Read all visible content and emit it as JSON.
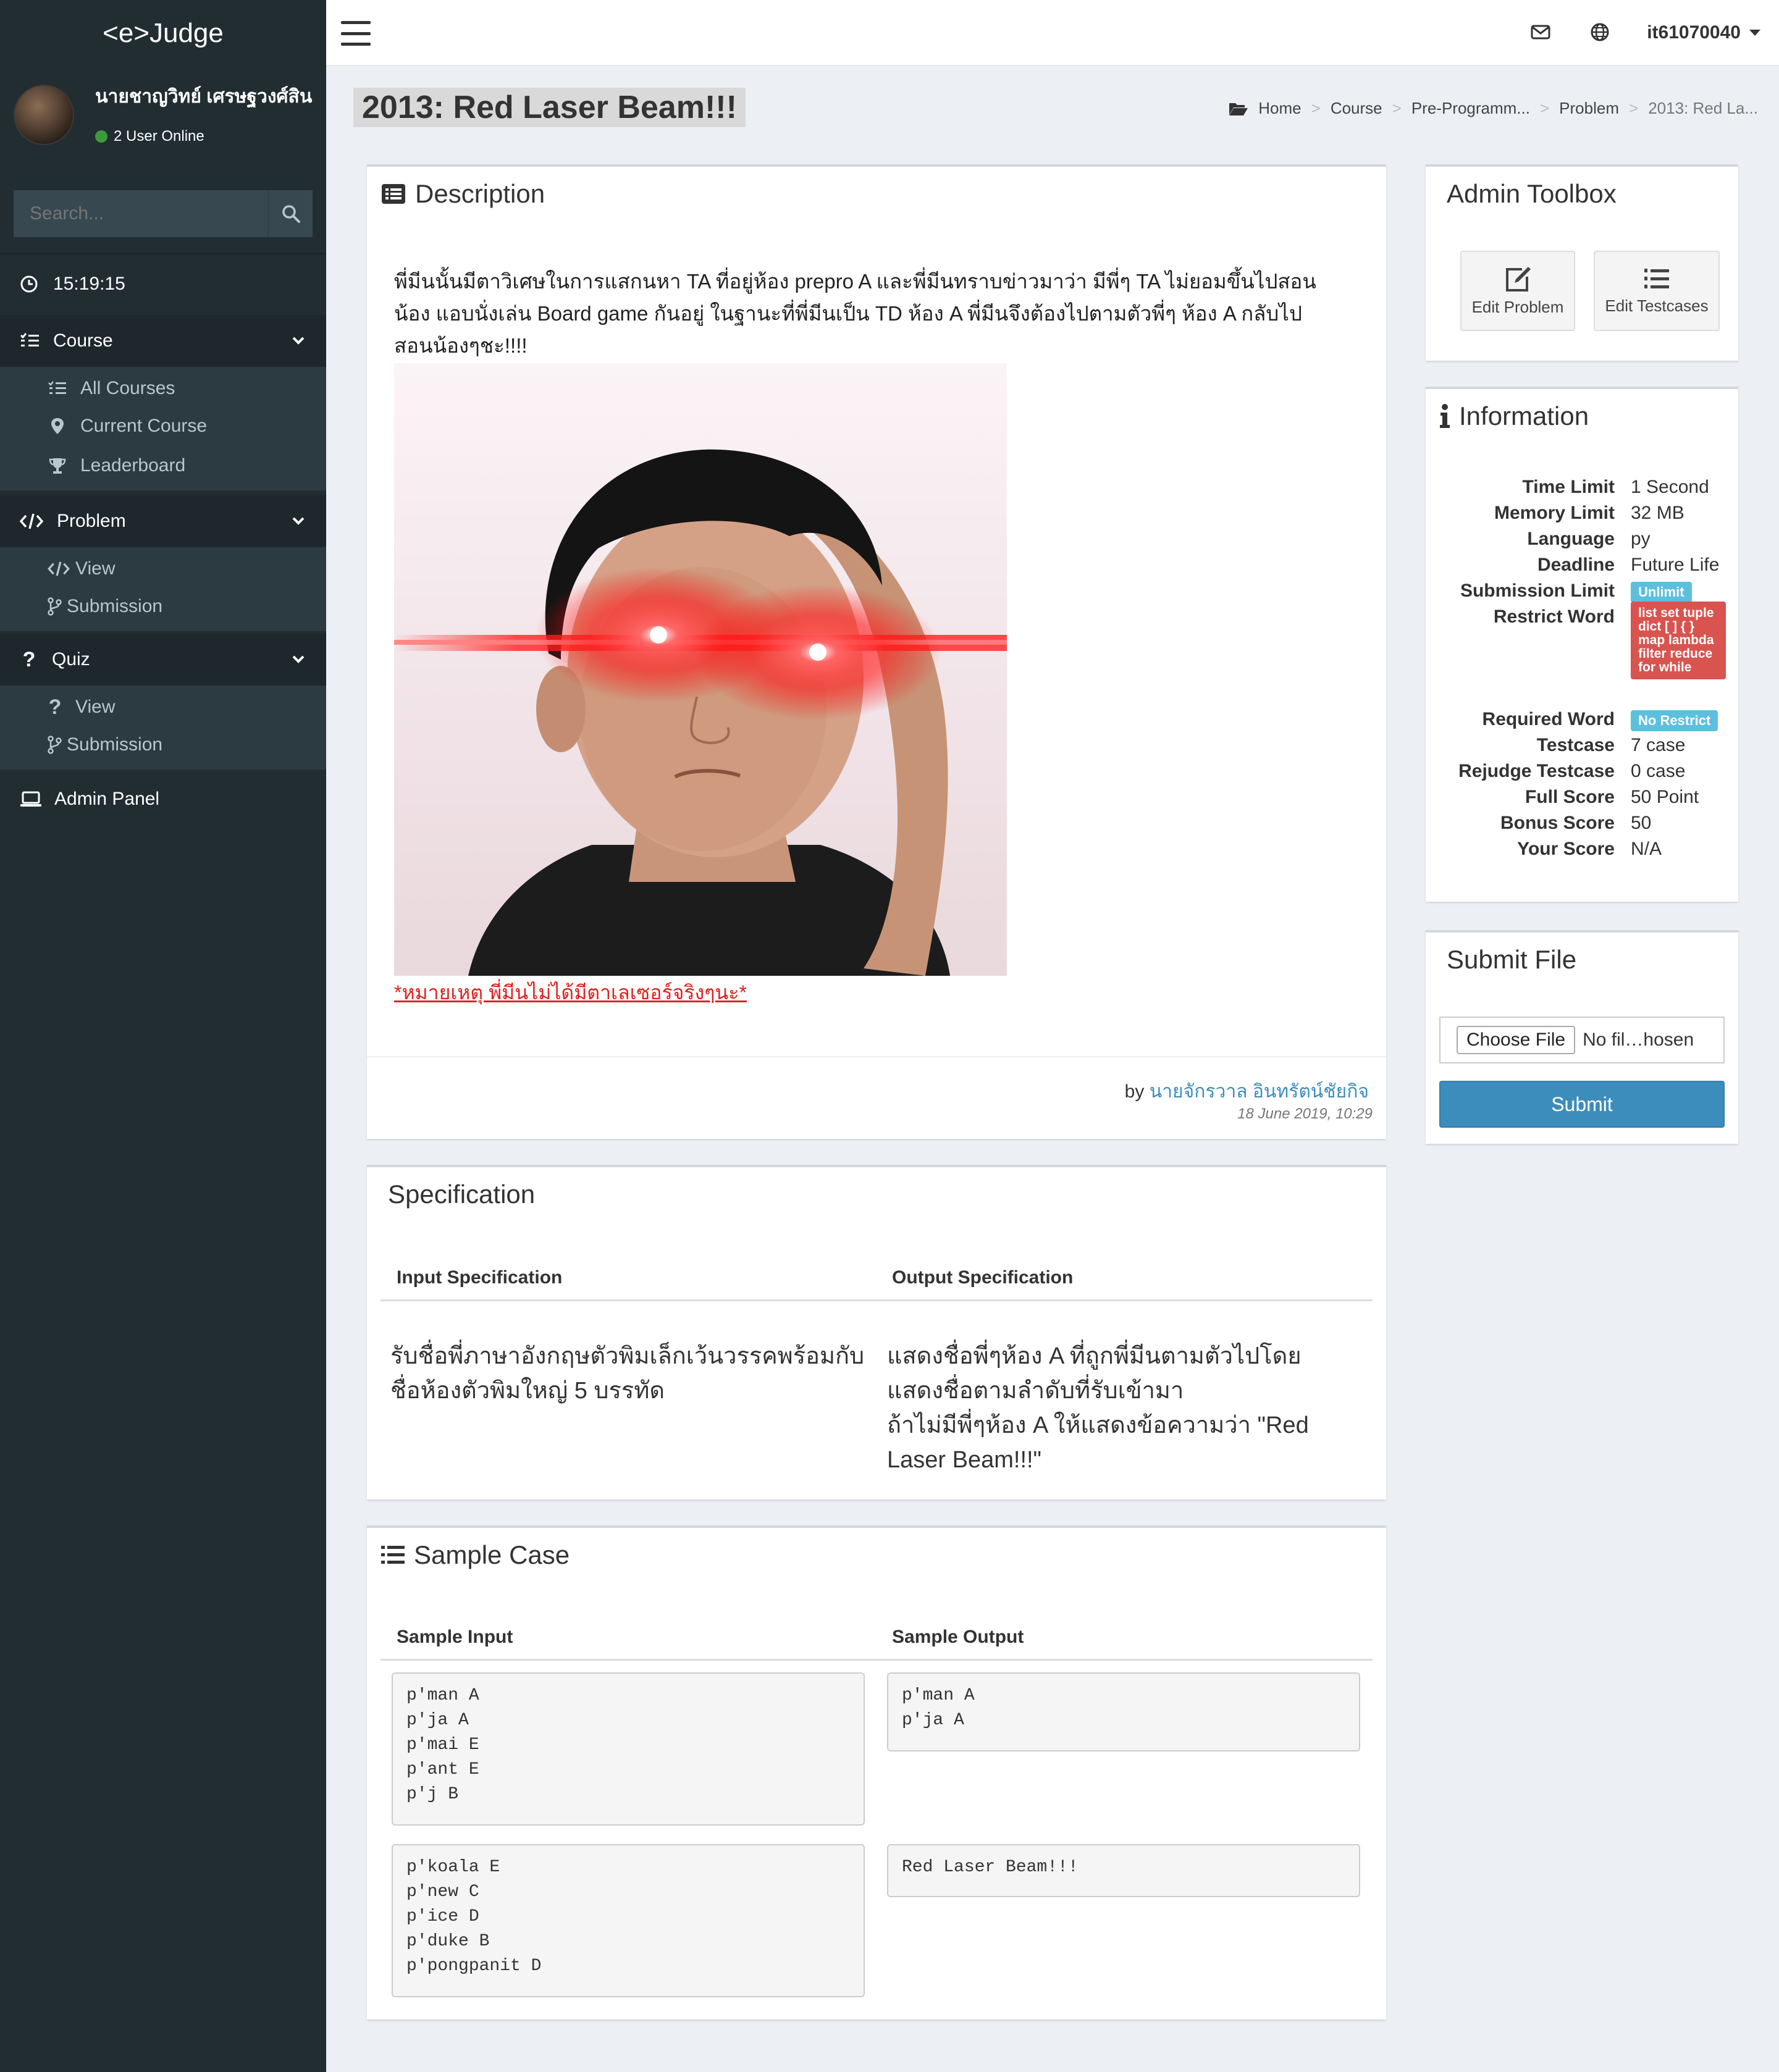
{
  "app": {
    "logo": "<e>Judge"
  },
  "user": {
    "name": "นายชาญวิทย์ เศรษฐวงศ์สิน",
    "online": "2 User Online",
    "top_username": "it61070040"
  },
  "search": {
    "placeholder": "Search..."
  },
  "clock": "15:19:15",
  "sidebar": {
    "course": {
      "label": "Course",
      "items": [
        "All Courses",
        "Current Course",
        "Leaderboard"
      ]
    },
    "problem": {
      "label": "Problem",
      "items": [
        "View",
        "Submission"
      ]
    },
    "quiz": {
      "label": "Quiz",
      "items": [
        "View",
        "Submission"
      ]
    },
    "admin": "Admin Panel"
  },
  "page": {
    "title": "2013: Red Laser Beam!!!"
  },
  "breadcrumb": [
    "Home",
    "Course",
    "Pre-Programm...",
    "Problem",
    "2013: Red La..."
  ],
  "description": {
    "title": "Description",
    "text": "พี่มีนนั้นมีตาวิเศษในการแสกนหา TA ที่อยู่ห้อง prepro A  และพี่มีนทราบข่าวมาว่า มีพี่ๆ TA ไม่ยอมขึ้นไปสอนน้อง แอบนั่งเล่น Board game กันอยู่ ในฐานะที่พี่มีนเป็น TD ห้อง A พี่มีนจึงต้องไปตามตัวพี่ๆ ห้อง A กลับไปสอนน้องๆชะ!!!!",
    "note": "*หมายเหตุ พี่มีนไม่ได้มีตาเลเซอร์จริงๆนะ*",
    "by_prefix": "by",
    "author": "นายจักรวาล อินทรัตน์ชัยกิจ",
    "date": "18 June 2019, 10:29"
  },
  "specification": {
    "title": "Specification",
    "input_head": "Input Specification",
    "output_head": "Output Specification",
    "input_text": "รับชื่อพี่ภาษาอังกฤษตัวพิมเล็กเว้นวรรคพร้อมกับชื่อห้องตัวพิมใหญ่ 5 บรรทัด",
    "output_line1": "แสดงชื่อพี่ๆห้อง A ที่ถูกพี่มีนตามตัวไปโดยแสดงชื่อตามลำดับที่รับเข้ามา",
    "output_line2": "ถ้าไม่มีพี่ๆห้อง A ให้แสดงข้อความว่า \"Red Laser Beam!!!\""
  },
  "sample": {
    "title": "Sample Case",
    "input_head": "Sample Input",
    "output_head": "Sample Output",
    "cases": [
      {
        "input": "p'man A\np'ja A\np'mai E\np'ant E\np'j B",
        "output": "p'man A\np'ja A"
      },
      {
        "input": "p'koala E\np'new C\np'ice D\np'duke B\np'pongpanit D",
        "output": "Red Laser Beam!!!"
      }
    ]
  },
  "toolbox": {
    "title": "Admin Toolbox",
    "edit_problem": "Edit Problem",
    "edit_testcases": "Edit Testcases"
  },
  "information": {
    "title": "Information",
    "time_limit_label": "Time Limit",
    "time_limit": "1 Second",
    "memory_limit_label": "Memory Limit",
    "memory_limit": "32 MB",
    "language_label": "Language",
    "language": "py",
    "deadline_label": "Deadline",
    "deadline": "Future Life",
    "submission_limit_label": "Submission Limit",
    "submission_limit": "Unlimit",
    "restrict_word_label": "Restrict Word",
    "restrict_word": "list set tuple dict [ ] { } map lambda filter reduce for while",
    "required_word_label": "Required Word",
    "required_word": "No Restrict",
    "testcase_label": "Testcase",
    "testcase": "7 case",
    "rejudge_label": "Rejudge Testcase",
    "rejudge": "0 case",
    "full_score_label": "Full Score",
    "full_score": "50 Point",
    "bonus_score_label": "Bonus Score",
    "bonus_score": "50",
    "your_score_label": "Your Score",
    "your_score": "N/A"
  },
  "submit": {
    "title": "Submit File",
    "choose_file": "Choose File",
    "no_file": "No fil…hosen",
    "submit": "Submit"
  },
  "icons": [
    "envelope-icon",
    "globe-icon",
    "search-icon",
    "clock-icon",
    "list-icon",
    "map-marker-icon",
    "trophy-icon",
    "code-icon",
    "branch-icon",
    "question-icon",
    "laptop-icon",
    "folder-open-icon",
    "edit-icon",
    "info-icon"
  ]
}
